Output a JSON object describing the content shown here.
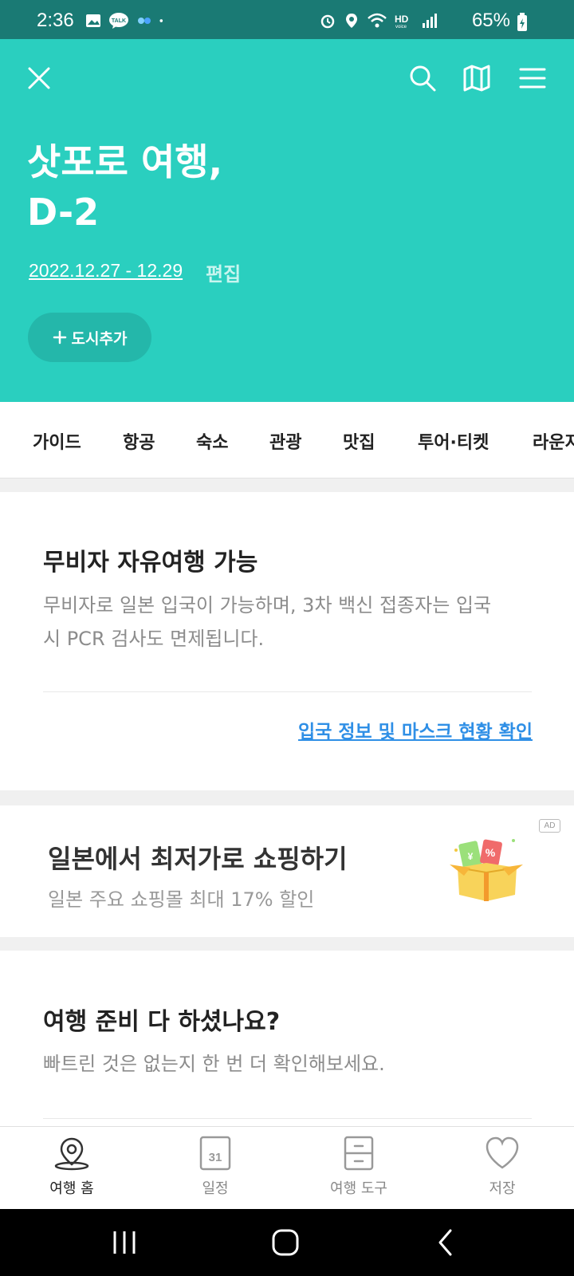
{
  "status_bar": {
    "time": "2:36",
    "battery": "65%",
    "left_icons": [
      "image-icon",
      "talk-icon",
      "link-icon",
      "dot-icon"
    ],
    "right_icons": [
      "alarm-icon",
      "location-icon",
      "wifi-icon",
      "hd-voice-icon",
      "signal-icon",
      "battery-icon"
    ]
  },
  "header": {
    "title_line1": "삿포로 여행,",
    "title_line2": "D-2",
    "dates": "2022.12.27 - 12.29",
    "edit_label": "편집",
    "add_city_label": "도시추가",
    "bg_color": "#2acfbf"
  },
  "tabs": [
    {
      "label": "가이드"
    },
    {
      "label": "항공"
    },
    {
      "label": "숙소"
    },
    {
      "label": "관광"
    },
    {
      "label": "맛집"
    },
    {
      "label": "투어·티켓"
    },
    {
      "label": "라운지"
    }
  ],
  "notice": {
    "title": "무비자 자유여행 가능",
    "desc_line1": "무비자로 일본 입국이 가능하며, 3차 백신 접종자는 입국",
    "desc_line2": "시 PCR 검사도 면제됩니다.",
    "link": "입국 정보 및 마스크 현황 확인"
  },
  "ad": {
    "badge": "AD",
    "title": "일본에서 최저가로 쇼핑하기",
    "subtitle": "일본 주요 쇼핑몰 최대 17% 할인"
  },
  "prep": {
    "title": "여행 준비 다 하셨나요?",
    "desc": "빠트린 것은 없는지 한 번 더 확인해보세요."
  },
  "bottom_nav": [
    {
      "label": "여행 홈",
      "icon": "location-pin-icon"
    },
    {
      "label": "일정",
      "icon": "calendar-icon",
      "calendar_day": "31"
    },
    {
      "label": "여행 도구",
      "icon": "toolbox-icon"
    },
    {
      "label": "저장",
      "icon": "heart-icon"
    }
  ],
  "colors": {
    "accent": "#2acfbf",
    "link": "#2f8fe6",
    "status_bar": "#1a7a74"
  }
}
